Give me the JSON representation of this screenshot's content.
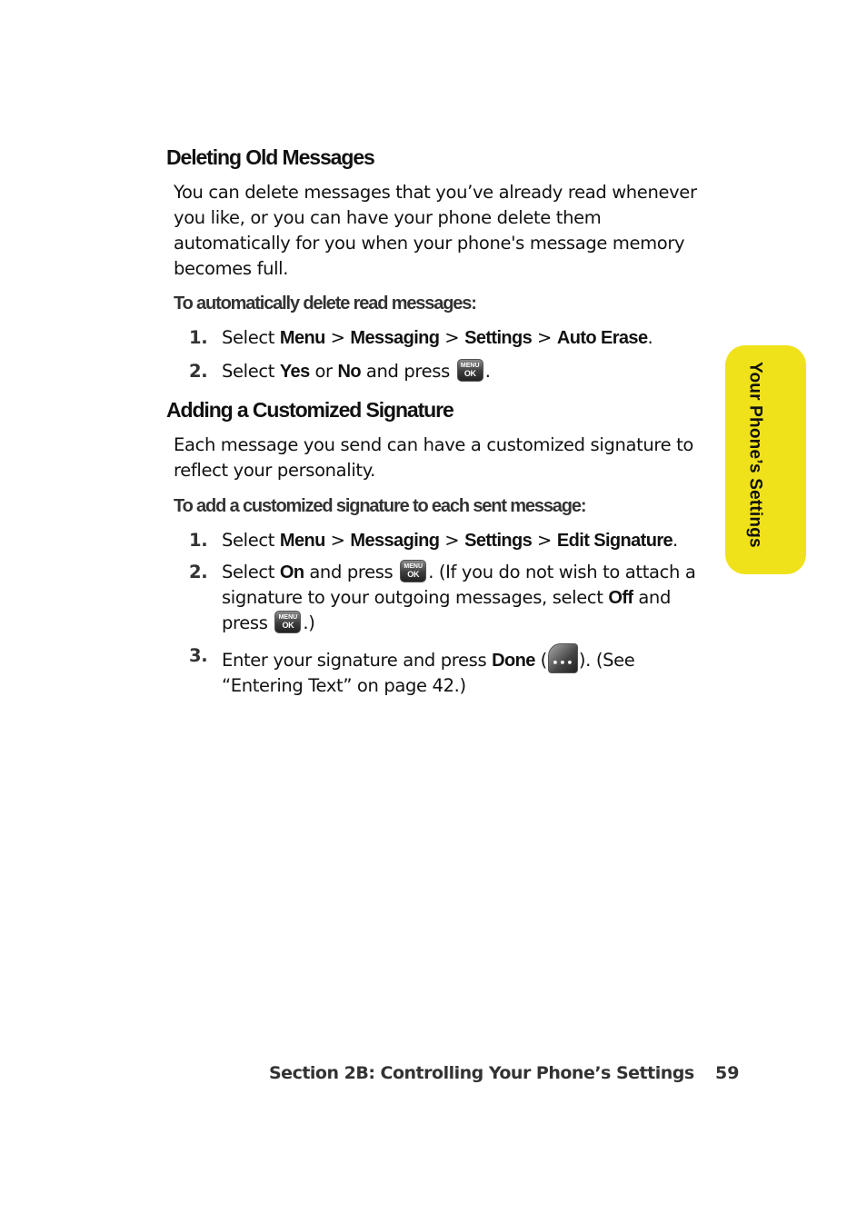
{
  "sections": [
    {
      "heading": "Deleting Old Messages",
      "intro": "You can delete messages that you’ve already read whenever you like, or you can have your phone delete them automatically for you when your phone's message memory becomes full.",
      "subheading": "To automatically delete read messages:",
      "steps": [
        {
          "num": "1.",
          "parts": [
            "Select ",
            "Menu",
            " > ",
            "Messaging",
            " > ",
            "Settings",
            " > ",
            "Auto Erase",
            "."
          ]
        },
        {
          "num": "2.",
          "parts": [
            "Select ",
            "Yes",
            " or ",
            "No",
            " and press ",
            "."
          ]
        }
      ]
    },
    {
      "heading": "Adding a Customized Signature",
      "intro": "Each message you send can have a customized signature to reflect your personality.",
      "subheading": "To add a customized signature to each sent message:",
      "steps": [
        {
          "num": "1.",
          "parts": [
            "Select ",
            "Menu",
            " > ",
            "Messaging",
            " > ",
            "Settings",
            " > ",
            "Edit Signature",
            "."
          ]
        },
        {
          "num": "2.",
          "parts": [
            "Select ",
            "On",
            " and press ",
            ". (If you do not wish to attach a signature to your outgoing messages, select ",
            "Off",
            " and press ",
            ".)"
          ]
        },
        {
          "num": "3.",
          "parts": [
            "Enter your signature and press ",
            "Done",
            " (",
            "). (See “Entering Text” on page 42.)"
          ]
        }
      ]
    }
  ],
  "icons": {
    "menu_ok_key": {
      "line1": "MENU",
      "line2": "OK"
    },
    "softkey": {
      "glyph": "•••"
    }
  },
  "side_tab": {
    "label": "Your Phone’s Settings",
    "color": "#efe21b"
  },
  "footer": {
    "section": "Section 2B: Controlling Your Phone’s Settings",
    "page": "59"
  }
}
